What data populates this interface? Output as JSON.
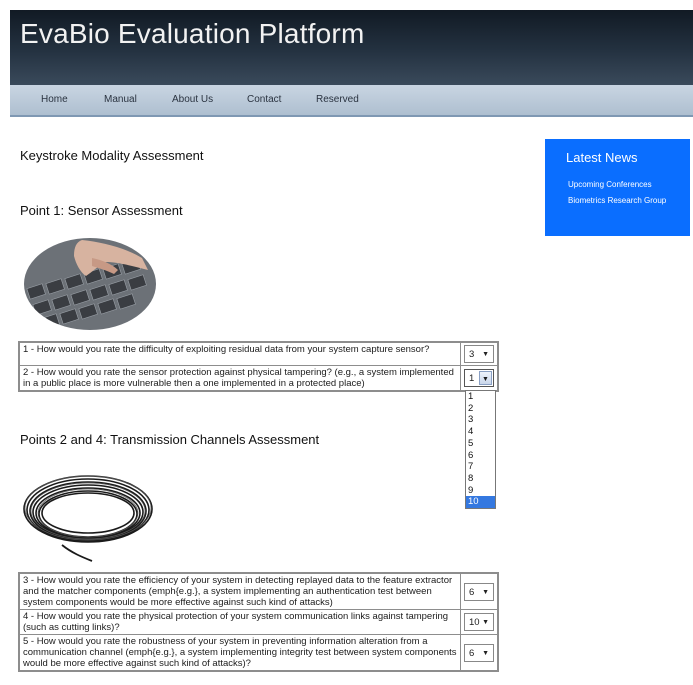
{
  "header": {
    "title": "EvaBio Evaluation Platform"
  },
  "nav": [
    "Home",
    "Manual",
    "About Us",
    "Contact",
    "Reserved"
  ],
  "main": {
    "heading": "Keystroke Modality Assessment",
    "point1_title": "Point 1: Sensor Assessment",
    "point2_title": "Points 2 and 4: Transmission Channels Assessment"
  },
  "news": {
    "title": "Latest News",
    "links": [
      "Upcoming Conferences",
      "Biometrics Research Group"
    ]
  },
  "questions1": [
    {
      "text": "1 - How would you rate the difficulty of exploiting residual data from your system capture sensor?",
      "value": "3"
    },
    {
      "text": "2 - How would you rate the sensor protection against physical tampering? (e.g., a system implemented in a public place is more vulnerable then a one implemented in a protected place)",
      "value": "1"
    }
  ],
  "dropdown_options": [
    "1",
    "2",
    "3",
    "4",
    "5",
    "6",
    "7",
    "8",
    "9",
    "10"
  ],
  "dropdown_highlighted": "10",
  "questions2": [
    {
      "text": "3 - How would you rate the efficiency of your system in detecting replayed data to the feature extractor and the matcher components (emph{e.g.}, a system implementing an authentication test between system components would be more effective against such kind of attacks)",
      "value": "6"
    },
    {
      "text": "4 - How would you rate the physical protection of your system communication links against tampering (such as cutting links)?",
      "value": "10"
    },
    {
      "text": "5 - How would you rate the robustness of your system in preventing information alteration from a communication channel (emph{e.g.}, a system implementing integrity test between system components would be more effective against such kind of attacks)?",
      "value": "6"
    }
  ]
}
